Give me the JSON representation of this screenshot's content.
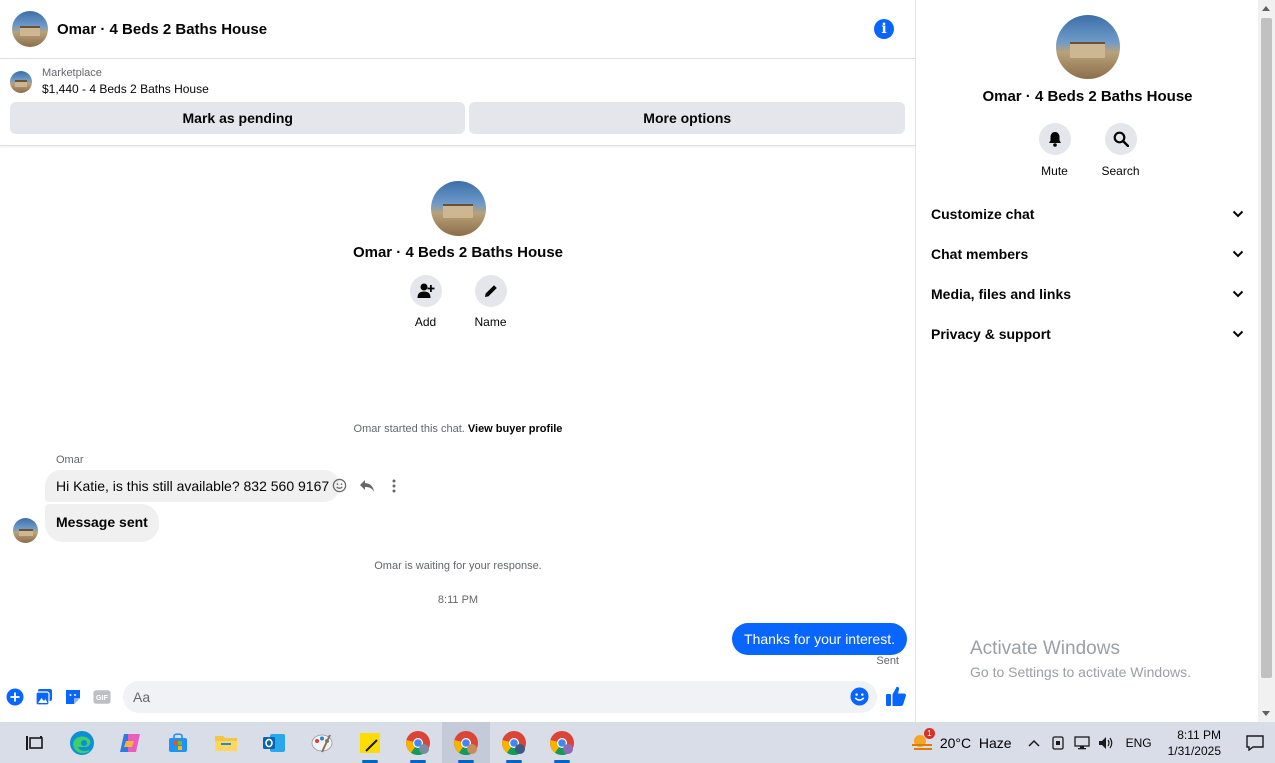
{
  "chat": {
    "header_title": "Omar · 4 Beds 2 Baths House",
    "marketplace": {
      "label": "Marketplace",
      "listing": "$1,440 - 4 Beds 2 Baths House",
      "mark_pending": "Mark as pending",
      "more_options": "More options"
    },
    "intro": {
      "name": "Omar · 4 Beds 2 Baths House",
      "add_label": "Add",
      "name_label": "Name"
    },
    "started_text": "Omar started this chat.",
    "view_buyer_profile": "View buyer profile",
    "sender_name": "Omar",
    "messages_in": [
      "Hi Katie, is this still available? 832 560 9167",
      "Message sent"
    ],
    "waiting_text": "Omar is waiting for your response.",
    "timestamp": "8:11 PM",
    "message_out": "Thanks for your interest.",
    "sent_status": "Sent",
    "composer_placeholder": "Aa"
  },
  "info_panel": {
    "name": "Omar · 4 Beds 2 Baths House",
    "mute_label": "Mute",
    "search_label": "Search",
    "sections": [
      "Customize chat",
      "Chat members",
      "Media, files and links",
      "Privacy & support"
    ]
  },
  "watermark": {
    "title": "Activate Windows",
    "subtitle": "Go to Settings to activate Windows."
  },
  "taskbar": {
    "apps": [
      "task-view",
      "edge",
      "copilot",
      "store",
      "file-explorer",
      "outlook",
      "paint",
      "sticky-notes",
      "chrome",
      "chrome",
      "chrome",
      "chrome"
    ],
    "weather_badge": "1",
    "weather": "20°C  Haze",
    "language": "ENG",
    "time": "8:11 PM",
    "date": "1/31/2025"
  },
  "colors": {
    "accent": "#0866ff",
    "bubble_in": "#f0f0f0",
    "button_bg": "#e4e6eb"
  }
}
